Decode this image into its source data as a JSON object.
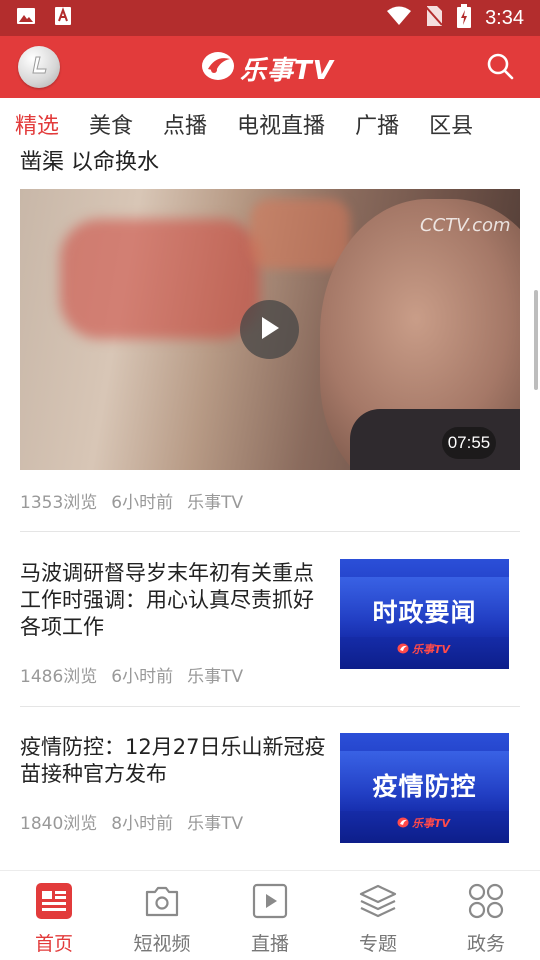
{
  "status_bar": {
    "time": "3:34",
    "left_icons": [
      "image-icon",
      "font-icon"
    ],
    "right_icons": [
      "wifi-icon",
      "no-sim-icon",
      "battery-icon"
    ]
  },
  "header": {
    "brand": "乐事TV",
    "left_icon": "app-logo-icon",
    "right_icon": "search-icon",
    "color": "#e23b3b"
  },
  "tabs": [
    {
      "label": "精选",
      "active": true
    },
    {
      "label": "美食",
      "active": false
    },
    {
      "label": "点播",
      "active": false
    },
    {
      "label": "电视直播",
      "active": false
    },
    {
      "label": "广播",
      "active": false
    },
    {
      "label": "区县",
      "active": false
    }
  ],
  "feed": {
    "partial_title": "凿渠 以命换水",
    "video_item": {
      "duration": "07:55",
      "watermark": "CCTV.com",
      "views": "1353浏览",
      "time": "6小时前",
      "source": "乐事TV"
    },
    "news_items": [
      {
        "title": "马波调研督导岁末年初有关重点工作时强调：用心认真尽责抓好各项工作",
        "thumb_text": "时政要闻",
        "thumb_logo": "乐事TV",
        "views": "1486浏览",
        "time": "6小时前",
        "source": "乐事TV"
      },
      {
        "title": "疫情防控：12月27日乐山新冠疫苗接种官方发布",
        "thumb_text": "疫情防控",
        "thumb_logo": "乐事TV",
        "views": "1840浏览",
        "time": "8小时前",
        "source": "乐事TV"
      }
    ]
  },
  "bottom_nav": [
    {
      "label": "首页",
      "icon": "news-home-icon",
      "active": true
    },
    {
      "label": "短视频",
      "icon": "camera-icon",
      "active": false
    },
    {
      "label": "直播",
      "icon": "play-square-icon",
      "active": false
    },
    {
      "label": "专题",
      "icon": "layers-icon",
      "active": false
    },
    {
      "label": "政务",
      "icon": "grid-circles-icon",
      "active": false
    }
  ]
}
